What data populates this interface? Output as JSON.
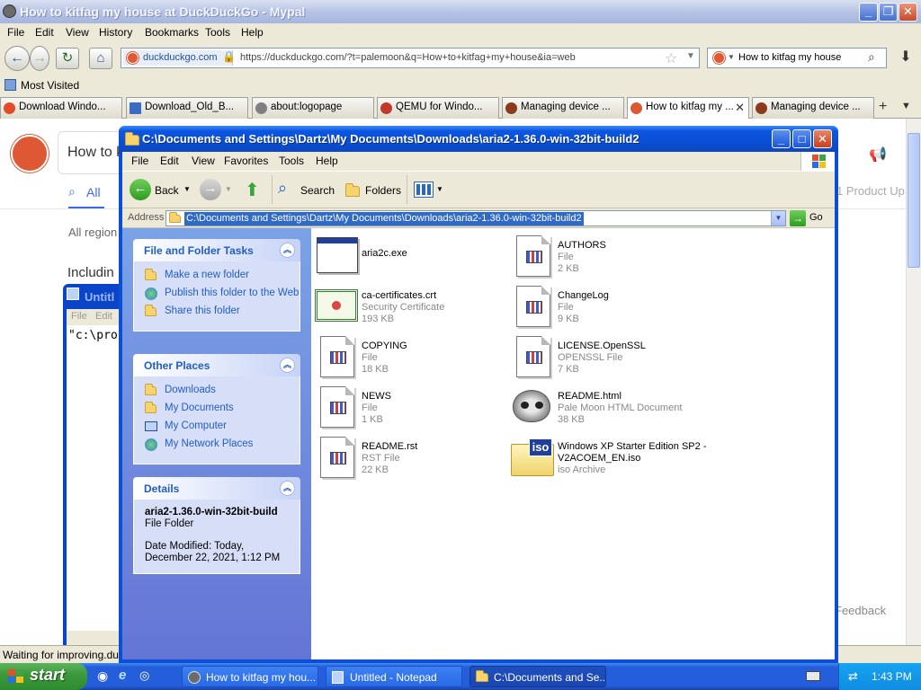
{
  "browser": {
    "title": "How to kitfag my house at DuckDuckGo - Mypal",
    "menu": [
      "File",
      "Edit",
      "View",
      "History",
      "Bookmarks",
      "Tools",
      "Help"
    ],
    "url_site": "duckduckgo.com",
    "url": "https://duckduckgo.com/?t=palemoon&q=How+to+kitfag+my+house&ia=web",
    "search_value": "How to kitfag my house",
    "bookmark": "Most Visited",
    "tabs": [
      {
        "label": "Download Windo...",
        "icon_color": "#e24b28"
      },
      {
        "label": "Download_Old_B...",
        "icon_color": "#3a6cc4"
      },
      {
        "label": "about:logopage",
        "icon_color": "#808080"
      },
      {
        "label": "QEMU for Windo...",
        "icon_color": "#c0392b"
      },
      {
        "label": "Managing device ...",
        "icon_color": "#8b3a1a"
      },
      {
        "label": "How to kitfag my ...",
        "icon_color": "#de5833"
      },
      {
        "label": "Managing device ...",
        "icon_color": "#8b3a1a"
      }
    ],
    "page": {
      "search_query": "How to k",
      "tab_all": "All",
      "region": "All region",
      "including": "Includin",
      "product_updates": "1 Product Up",
      "feedback": "Feedback"
    },
    "status": "Waiting for improving.duck"
  },
  "notepad": {
    "title": "Untitl",
    "menu": [
      "File",
      "Edit"
    ],
    "content": "\"c:\\pro"
  },
  "explorer": {
    "title": "C:\\Documents and Settings\\Dartz\\My Documents\\Downloads\\aria2-1.36.0-win-32bit-build2",
    "menu": [
      "File",
      "Edit",
      "View",
      "Favorites",
      "Tools",
      "Help"
    ],
    "toolbar": {
      "back": "Back",
      "search": "Search",
      "folders": "Folders"
    },
    "address_label": "Address",
    "address": "C:\\Documents and Settings\\Dartz\\My Documents\\Downloads\\aria2-1.36.0-win-32bit-build2",
    "go": "Go",
    "panels": {
      "tasks": {
        "title": "File and Folder Tasks",
        "items": [
          "Make a new folder",
          "Publish this folder to the Web",
          "Share this folder"
        ]
      },
      "places": {
        "title": "Other Places",
        "items": [
          "Downloads",
          "My Documents",
          "My Computer",
          "My Network Places"
        ]
      },
      "details": {
        "title": "Details",
        "name": "aria2-1.36.0-win-32bit-build",
        "type": "File Folder",
        "modified": "Date Modified: Today, December 22, 2021, 1:12 PM"
      }
    },
    "files": [
      {
        "name": "aria2c.exe",
        "type": "",
        "size": ""
      },
      {
        "name": "AUTHORS",
        "type": "File",
        "size": "2 KB"
      },
      {
        "name": "ca-certificates.crt",
        "type": "Security Certificate",
        "size": "193 KB"
      },
      {
        "name": "ChangeLog",
        "type": "File",
        "size": "9 KB"
      },
      {
        "name": "COPYING",
        "type": "File",
        "size": "18 KB"
      },
      {
        "name": "LICENSE.OpenSSL",
        "type": "OPENSSL File",
        "size": "7 KB"
      },
      {
        "name": "NEWS",
        "type": "File",
        "size": "1 KB"
      },
      {
        "name": "README.html",
        "type": "Pale Moon HTML Document",
        "size": "38 KB"
      },
      {
        "name": "README.rst",
        "type": "RST File",
        "size": "22 KB"
      },
      {
        "name": "Windows XP Starter Edition SP2 -\nV2ACOEM_EN.iso",
        "type": "iso Archive",
        "size": ""
      }
    ]
  },
  "taskbar": {
    "start": "start",
    "buttons": [
      "How to kitfag my hou...",
      "Untitled - Notepad",
      "C:\\Documents and Se..."
    ],
    "clock": "1:43 PM"
  },
  "colors": {
    "xp_blue": "#0c4fd4",
    "link_blue": "#215dc6",
    "ddg_orange": "#de5833",
    "start_green": "#3c9a3c"
  }
}
